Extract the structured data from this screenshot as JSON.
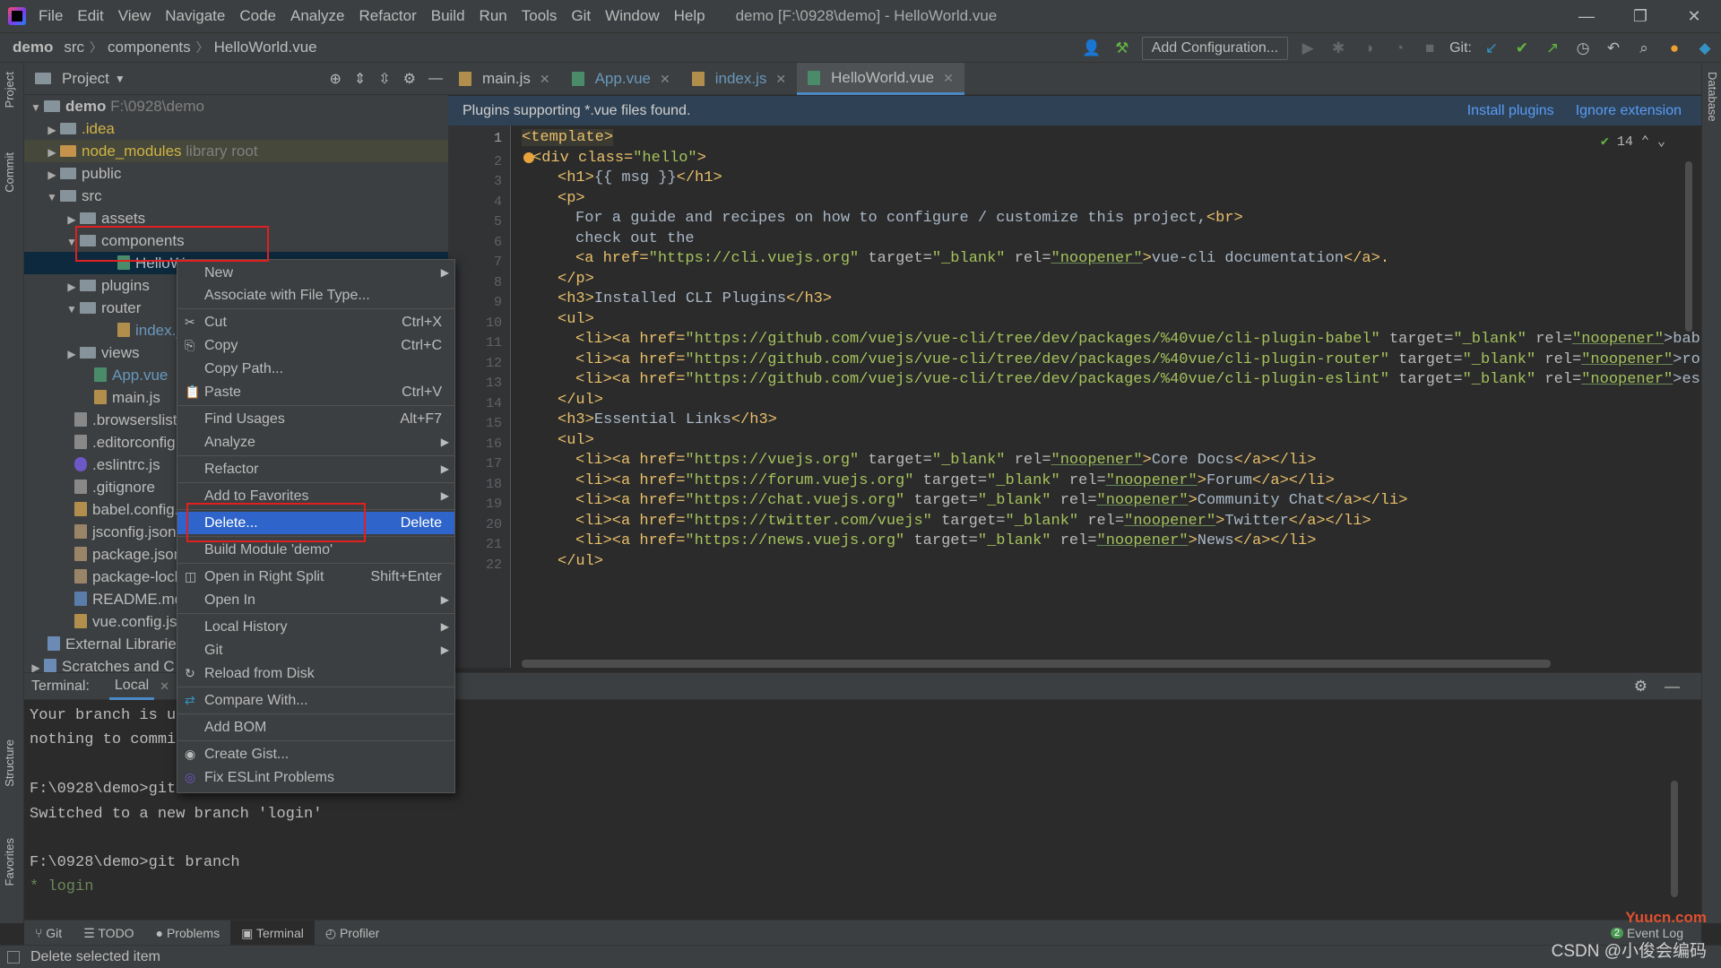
{
  "menu": [
    "File",
    "Edit",
    "View",
    "Navigate",
    "Code",
    "Analyze",
    "Refactor",
    "Build",
    "Run",
    "Tools",
    "Git",
    "Window",
    "Help"
  ],
  "window_title": "demo [F:\\0928\\demo] - HelloWorld.vue",
  "breadcrumb": {
    "root": "demo",
    "b1": "src",
    "b2": "components",
    "b3": "HelloWorld.vue"
  },
  "toolbar": {
    "add_config": "Add Configuration...",
    "git_label": "Git:"
  },
  "left_strip": {
    "project": "Project",
    "commit": "Commit",
    "structure": "Structure",
    "favorites": "Favorites"
  },
  "right_strip": {
    "database": "Database"
  },
  "project_panel": {
    "title": "Project",
    "tree": [
      {
        "label": "demo",
        "extra": "F:\\0928\\demo"
      },
      {
        "label": ".idea"
      },
      {
        "label": "node_modules",
        "extra": "library root"
      },
      {
        "label": "public"
      },
      {
        "label": "src"
      },
      {
        "label": "assets"
      },
      {
        "label": "components"
      },
      {
        "label": "HelloW"
      },
      {
        "label": "plugins"
      },
      {
        "label": "router"
      },
      {
        "label": "index.j"
      },
      {
        "label": "views"
      },
      {
        "label": "App.vue"
      },
      {
        "label": "main.js"
      },
      {
        "label": ".browserslist"
      },
      {
        "label": ".editorconfig"
      },
      {
        "label": ".eslintrc.js"
      },
      {
        "label": ".gitignore"
      },
      {
        "label": "babel.config."
      },
      {
        "label": "jsconfig.json"
      },
      {
        "label": "package.json"
      },
      {
        "label": "package-lock"
      },
      {
        "label": "README.md"
      },
      {
        "label": "vue.config.js"
      },
      {
        "label": "External Librarie"
      },
      {
        "label": "Scratches and C"
      }
    ]
  },
  "editor_tabs": [
    {
      "label": "main.js"
    },
    {
      "label": "App.vue"
    },
    {
      "label": "index.js"
    },
    {
      "label": "HelloWorld.vue"
    }
  ],
  "banner": {
    "message": "Plugins supporting *.vue files found.",
    "install": "Install plugins",
    "ignore": "Ignore extension"
  },
  "inspection": "14",
  "line_numbers": [
    "1",
    "2",
    "3",
    "4",
    "5",
    "6",
    "7",
    "8",
    "9",
    "10",
    "11",
    "12",
    "13",
    "14",
    "15",
    "16",
    "17",
    "18",
    "19",
    "20",
    "21",
    "22"
  ],
  "code": {
    "l1": "<template>",
    "l2a": "<div class=",
    "l2b": "\"hello\"",
    "l2c": ">",
    "l3": "<h1>",
    "l3t": "{{ msg }}",
    "l3c": "</h1>",
    "l4": "<p>",
    "l5": "For a guide and recipes on how to configure / customize this project,",
    "l5b": "<br>",
    "l6": "check out the",
    "l7a": "<a href=",
    "l7b": "\"https://cli.vuejs.org\"",
    "l7c": " target=",
    "l7d": "\"_blank\"",
    "l7e": " rel=",
    "l7f": "\"noopener\"",
    "l7g": ">",
    "l7h": "vue-cli documentation",
    "l7i": "</a>.",
    "l8": "</p>",
    "l9": "<h3>",
    "l9t": "Installed CLI Plugins",
    "l9c": "</h3>",
    "l10": "<ul>",
    "l11a": "<li><a href=",
    "l11b": "\"https://github.com/vuejs/vue-cli/tree/dev/packages/%40vue/cli-plugin-babel\"",
    "l11c": " target=",
    "l11d": "\"_blank\"",
    "l11e": " rel=",
    "l11f": "\"noopener\"",
    "l11g": ">babel",
    "l12b": "\"https://github.com/vuejs/vue-cli/tree/dev/packages/%40vue/cli-plugin-router\"",
    "l12g": ">rout",
    "l13b": "\"https://github.com/vuejs/vue-cli/tree/dev/packages/%40vue/cli-plugin-eslint\"",
    "l13g": ">esli",
    "l14": "</ul>",
    "l15": "<h3>",
    "l15t": "Essential Links",
    "l15c": "</h3>",
    "l16": "<ul>",
    "l17b": "\"https://vuejs.org\"",
    "l17t": "Core Docs",
    "l18b": "\"https://forum.vuejs.org\"",
    "l18t": "Forum",
    "l19b": "\"https://chat.vuejs.org\"",
    "l19t": "Community Chat",
    "l20b": "\"https://twitter.com/vuejs\"",
    "l20t": "Twitter",
    "l21b": "\"https://news.vuejs.org\"",
    "l21t": "News",
    "close_a": "</a></li>",
    "l22": "</ul>"
  },
  "terminal": {
    "label": "Terminal:",
    "tab": "Local",
    "lines": [
      "Your branch is up",
      "nothing to commit",
      "",
      "F:\\0928\\demo>git",
      "Switched to a new branch 'login'",
      "",
      "F:\\0928\\demo>git branch",
      "* login"
    ]
  },
  "bottom_tabs": [
    "Git",
    "TODO",
    "Problems",
    "Terminal",
    "Profiler"
  ],
  "event_log": {
    "count": "2",
    "label": "Event Log"
  },
  "status": "Delete selected item",
  "watermark": "CSDN @小俊会编码",
  "watermark_site": "Yuucn.com",
  "context_menu": [
    {
      "label": "New",
      "sub": true
    },
    {
      "label": "Associate with File Type..."
    },
    {
      "label": "Cut",
      "shortcut": "Ctrl+X",
      "icon": "✂"
    },
    {
      "label": "Copy",
      "shortcut": "Ctrl+C",
      "icon": "⎘"
    },
    {
      "label": "Copy Path..."
    },
    {
      "label": "Paste",
      "shortcut": "Ctrl+V",
      "icon": "📋"
    },
    {
      "label": "Find Usages",
      "shortcut": "Alt+F7"
    },
    {
      "label": "Analyze",
      "sub": true
    },
    {
      "label": "Refactor",
      "sub": true
    },
    {
      "label": "Add to Favorites",
      "sub": true
    },
    {
      "label": "Delete...",
      "shortcut": "Delete"
    },
    {
      "label": "Build Module 'demo'"
    },
    {
      "label": "Open in Right Split",
      "shortcut": "Shift+Enter"
    },
    {
      "label": "Open In",
      "sub": true
    },
    {
      "label": "Local History",
      "sub": true
    },
    {
      "label": "Git",
      "sub": true
    },
    {
      "label": "Reload from Disk"
    },
    {
      "label": "Compare With..."
    },
    {
      "label": "Add BOM"
    },
    {
      "label": "Create Gist..."
    },
    {
      "label": "Fix ESLint Problems"
    }
  ],
  "colors": {
    "accent": "#2f65ca",
    "highlight_box": "#e02020",
    "selection": "#0d293e"
  }
}
